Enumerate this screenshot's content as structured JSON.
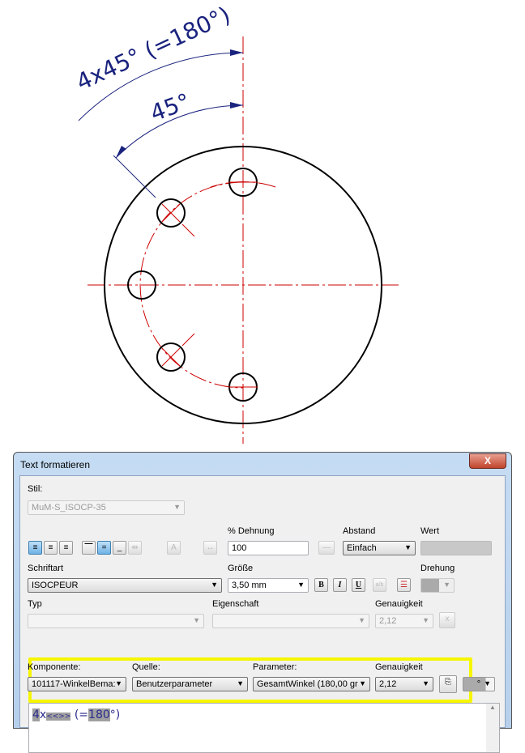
{
  "drawing": {
    "outer_dimension": "4x45° (=180°)",
    "inner_dimension": "45°"
  },
  "dialog": {
    "title": "Text formatieren",
    "close": "X",
    "stil_label": "Stil:",
    "stil_value": "MuM-S_ISOCP-35",
    "dehnung_label": "% Dehnung",
    "dehnung_value": "100",
    "abstand_label": "Abstand",
    "abstand_value": "Einfach",
    "wert_label": "Wert",
    "schriftart_label": "Schriftart",
    "schriftart_value": "ISOCPEUR",
    "groesse_label": "Größe",
    "groesse_value": "3,50 mm",
    "bold": "B",
    "italic": "I",
    "underline": "U",
    "stack": "a/b",
    "drehung_label": "Drehung",
    "typ_label": "Typ",
    "eigenschaft_label": "Eigenschaft",
    "genauigkeit_label": "Genauigkeit",
    "genauigkeit_value": "2,12",
    "komponente_label": "Komponente:",
    "komponente_value": "101117-WinkelBema:",
    "quelle_label": "Quelle:",
    "quelle_value": "Benutzerparameter",
    "parameter_label": "Parameter:",
    "parameter_value": "GesamtWinkel (180,00 gr",
    "genauigkeit2_label": "Genauigkeit",
    "genauigkeit2_value": "2,12",
    "symbol_value": "°",
    "editor": {
      "p1": "4",
      "p2": "x",
      "p3": "<<>>",
      "p4": " (=",
      "p5": "180",
      "p6": "°)"
    }
  }
}
